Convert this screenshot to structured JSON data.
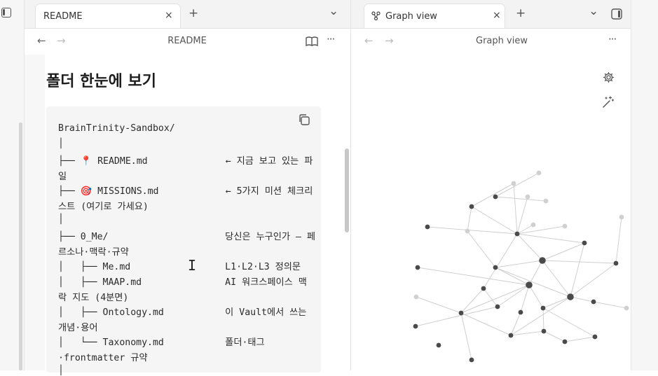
{
  "left_pane": {
    "tab": {
      "label": "README"
    },
    "header": {
      "title": "README"
    },
    "doc": {
      "heading": "폴더 한눈에 보기",
      "code_lines": [
        "BrainTrinity-Sandbox/",
        "│",
        "├── 📍 README.md              ← 지금 보고 있는 파",
        "일",
        "├── 🎯 MISSIONS.md            ← 5가지 미션 체크리",
        "스트 (여기로 가세요)",
        "│",
        "├── 0_Me/                     당신은 누구인가 — 페",
        "르소나·맥락·규약",
        "│   ├── Me.md                 L1·L2·L3 정의문",
        "│   ├── MAAP.md               AI 워크스페이스 맥",
        "락 지도 (4분면)",
        "│   ├── Ontology.md           이 Vault에서 쓰는",
        "개념·용어",
        "│   └── Taxonomy.md           폴더·태그",
        "·frontmatter 규약",
        "│"
      ]
    }
  },
  "right_pane": {
    "tab": {
      "label": "Graph view"
    },
    "header": {
      "title": "Graph view"
    }
  },
  "icons": {
    "close": "×",
    "new_tab": "+",
    "chevron": "⌄",
    "back": "←",
    "forward": "→",
    "more": "···",
    "cursor": "I"
  },
  "colors": {
    "node_dark": "#4a4a4a",
    "node_light": "#d0d0d0",
    "edge": "#cfcfcf"
  }
}
